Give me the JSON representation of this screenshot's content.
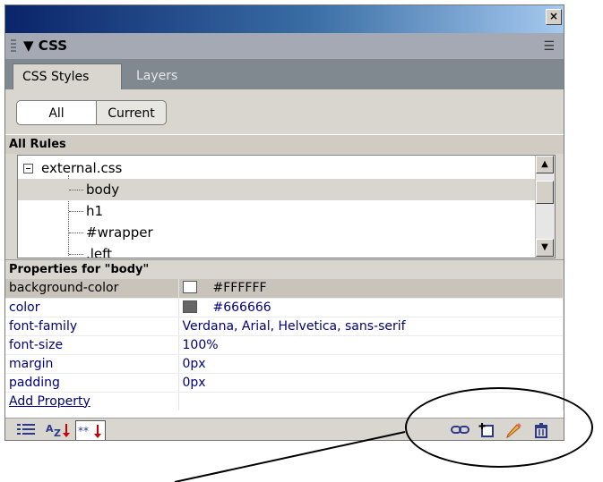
{
  "panel": {
    "title": "CSS",
    "close_glyph": "×",
    "options_glyph": "☰"
  },
  "tabs": [
    {
      "label": "CSS Styles",
      "active": true
    },
    {
      "label": "Layers",
      "active": false
    }
  ],
  "mode": {
    "all_label": "All",
    "current_label": "Current",
    "selected": "All"
  },
  "rules_section": {
    "label": "All Rules",
    "tree": {
      "file": "external.css",
      "rules": [
        "body",
        "h1",
        "#wrapper",
        ".left"
      ],
      "selected": "body"
    }
  },
  "properties_section": {
    "label": "Properties for \"body\"",
    "rows": [
      {
        "name": "background-color",
        "value": "#FFFFFF",
        "swatch": "#FFFFFF"
      },
      {
        "name": "color",
        "value": "#666666",
        "swatch": "#666666"
      },
      {
        "name": "font-family",
        "value": "Verdana, Arial, Helvetica, sans-serif"
      },
      {
        "name": "font-size",
        "value": "100%"
      },
      {
        "name": "margin",
        "value": "0px"
      },
      {
        "name": "padding",
        "value": "0px"
      }
    ],
    "add_property_label": "Add Property"
  },
  "bottom_toolbar": {
    "left_icons": [
      "category-view-icon",
      "alphabetical-view-icon",
      "set-properties-view-icon"
    ],
    "right_icons": [
      "attach-style-sheet-icon",
      "new-css-rule-icon",
      "edit-style-icon",
      "delete-css-rule-icon"
    ]
  },
  "annotation": {
    "shape": "ellipse",
    "highlights": "bottom-right toolbar icons"
  }
}
